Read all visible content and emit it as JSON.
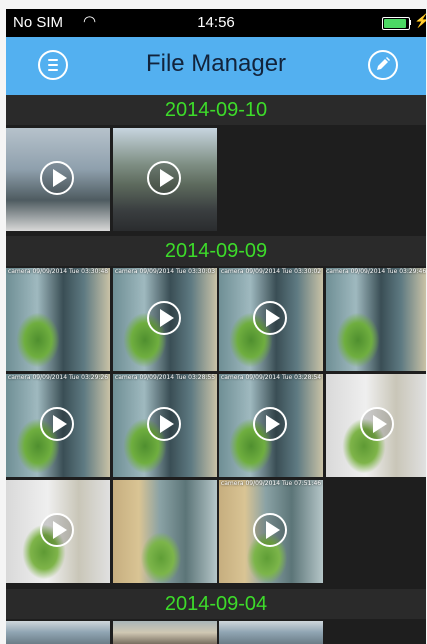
{
  "status_bar": {
    "carrier": "No SIM",
    "wifi_icon": "wifi-icon",
    "time": "14:56",
    "battery_level": 0.9,
    "charging_icon": "bolt-icon",
    "battery_color": "#4cd964"
  },
  "nav": {
    "title": "File Manager",
    "menu_icon": "menu-icon",
    "edit_icon": "pencil-icon",
    "bar_color": "#53b0f0"
  },
  "section_color": "#3ddb2a",
  "sections": [
    {
      "date": "2014-09-10",
      "items": [
        {
          "stamp": "",
          "video": true
        },
        {
          "stamp": "",
          "video": true
        }
      ]
    },
    {
      "date": "2014-09-09",
      "items": [
        {
          "stamp": "camera 09/09/2014 Tue 03:30:48",
          "video": false
        },
        {
          "stamp": "camera 09/09/2014 Tue 03:30:03",
          "video": true
        },
        {
          "stamp": "camera 09/09/2014 Tue 03:30:02",
          "video": true
        },
        {
          "stamp": "camera 09/09/2014 Tue 03:29:46",
          "video": false
        },
        {
          "stamp": "camera 09/09/2014 Tue 03:29:26",
          "video": true
        },
        {
          "stamp": "camera 09/09/2014 Tue 03:28:55",
          "video": true
        },
        {
          "stamp": "camera 09/09/2014 Tue 03:28:54",
          "video": true
        },
        {
          "stamp": "",
          "video": true
        },
        {
          "stamp": "",
          "video": true
        },
        {
          "stamp": "",
          "video": false
        },
        {
          "stamp": "camera 09/09/2014 Tue 07:51:46",
          "video": true
        }
      ]
    },
    {
      "date": "2014-09-04",
      "items": []
    }
  ]
}
